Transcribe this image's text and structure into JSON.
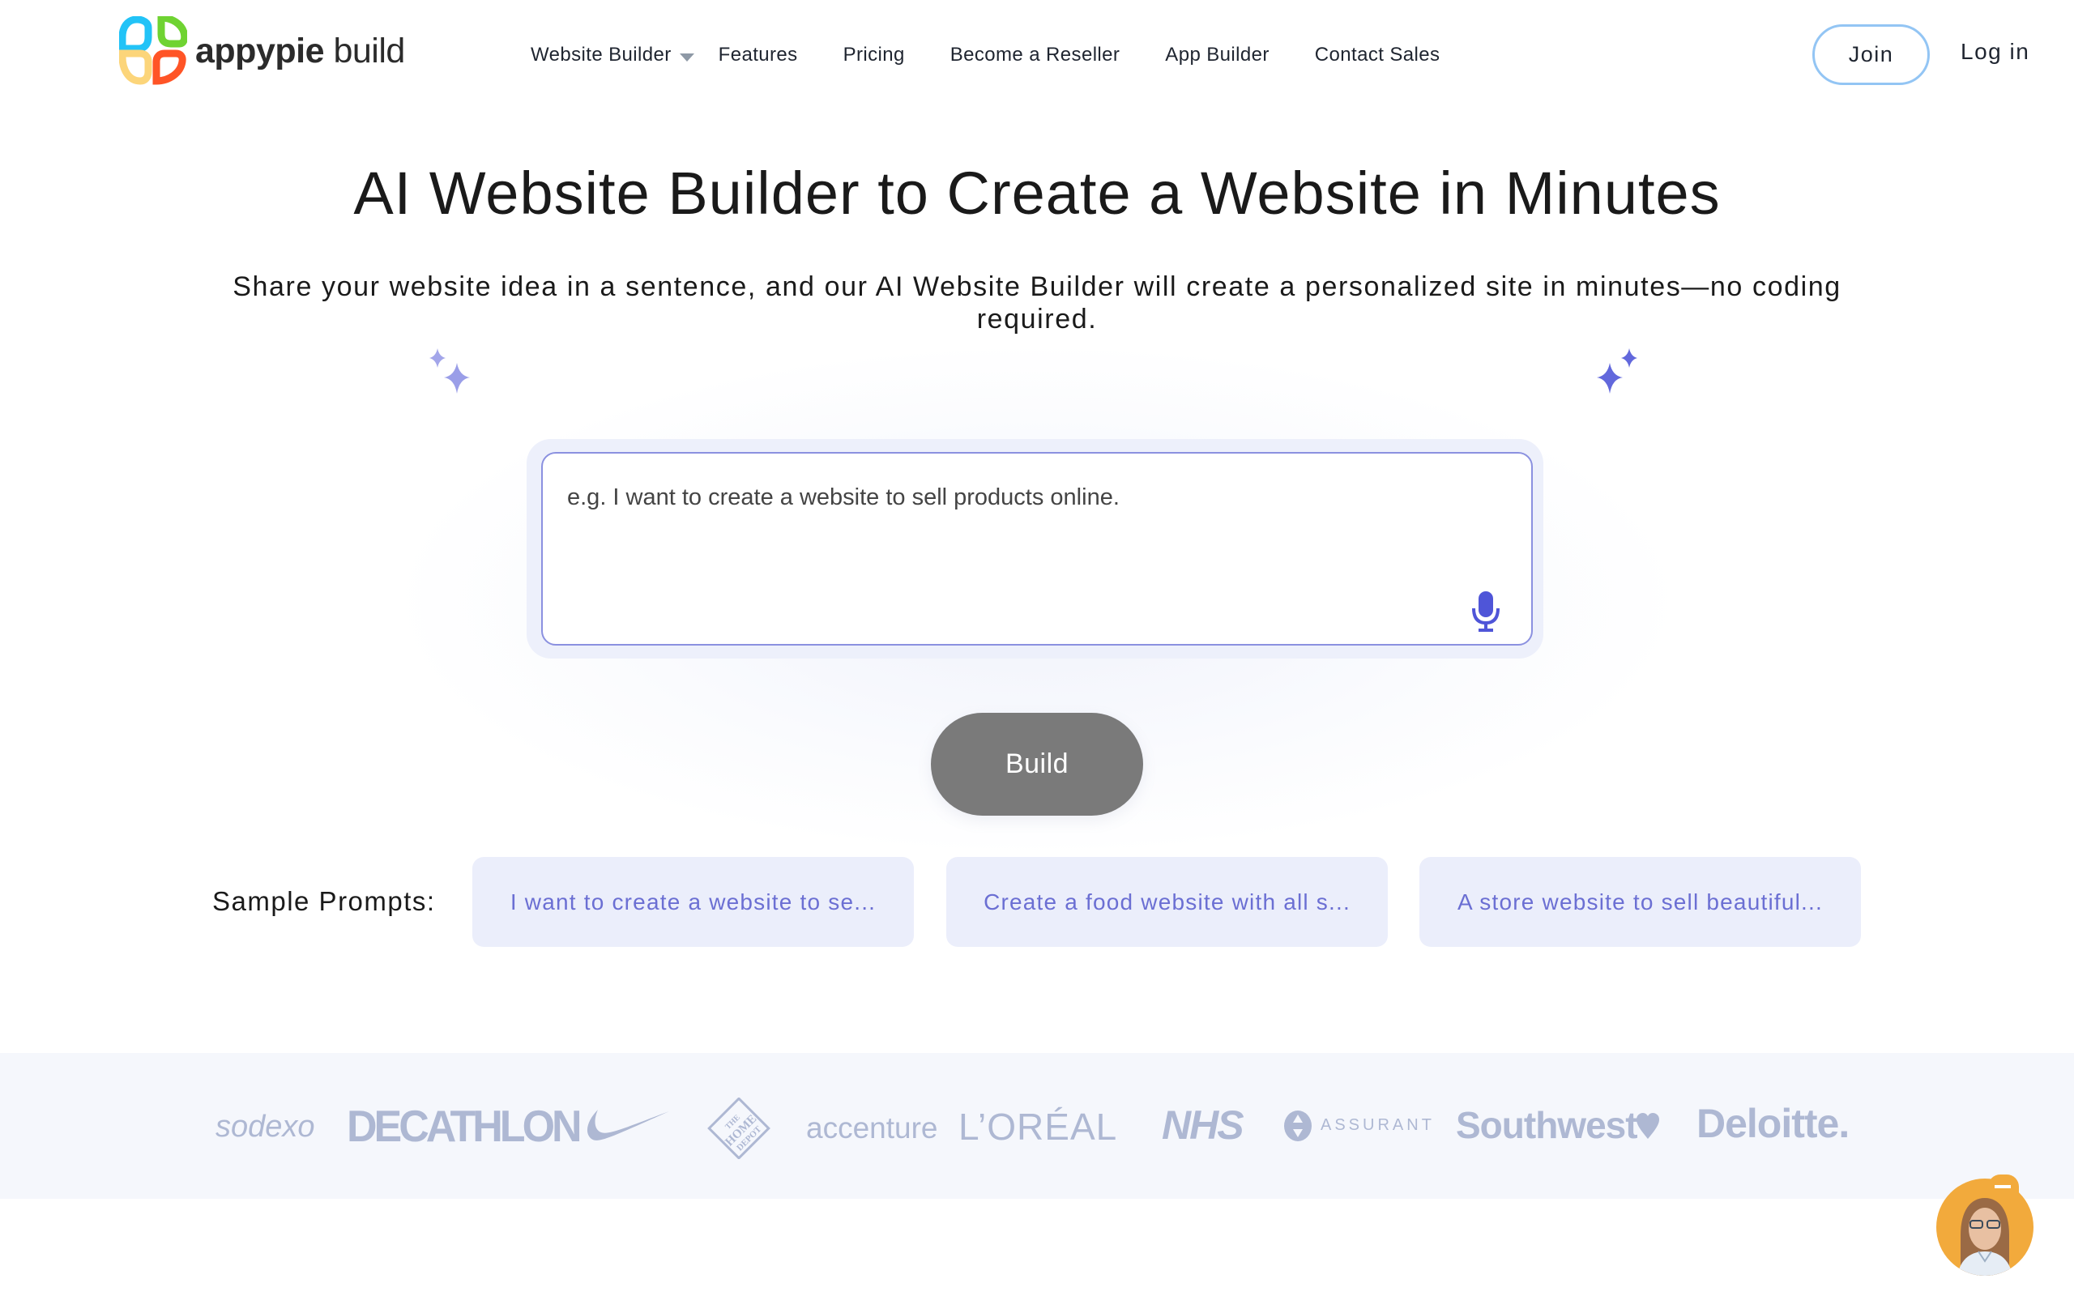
{
  "header": {
    "logo": {
      "brand_bold": "appypie",
      "brand_light": "build",
      "icon": "appypie-clover-logo-icon"
    },
    "nav": [
      {
        "label": "Website Builder",
        "has_dropdown": true
      },
      {
        "label": "Features",
        "has_dropdown": false
      },
      {
        "label": "Pricing",
        "has_dropdown": false
      },
      {
        "label": "Become a Reseller",
        "has_dropdown": false
      },
      {
        "label": "App Builder",
        "has_dropdown": false
      },
      {
        "label": "Contact Sales",
        "has_dropdown": false
      }
    ],
    "join_label": "Join",
    "login_label": "Log in"
  },
  "hero": {
    "title": "AI Website Builder to Create a Website in Minutes",
    "subtitle": "Share your website idea in a sentence, and our AI Website Builder will create a personalized site in minutes—no coding required.",
    "sparkle_icon": "sparkle-icon"
  },
  "prompt": {
    "value": "",
    "placeholder": "e.g. I want to create a website to sell products online.",
    "mic_icon": "microphone-icon"
  },
  "build_label": "Build",
  "samples": {
    "label": "Sample Prompts:",
    "chips": [
      "I want to create a website to se...",
      "Create a food website with all s...",
      "A store website to sell beautiful..."
    ]
  },
  "brands": {
    "sodexo": "sodexo",
    "decathlon": "DECATHLON",
    "nike": "nike-swoosh",
    "homedepot": "THE HOME DEPOT",
    "accenture": "accenture",
    "loreal": "L’ORÉAL",
    "nhs": "NHS",
    "assurant": "ASSURANT",
    "southwest": "Southwest",
    "deloitte": "Deloitte."
  },
  "colors": {
    "accent": "#6b6fd3",
    "build_button": "#7a7a7a",
    "join_border": "#93c5f4",
    "chip_bg": "#ebeefb",
    "logo_band_bg": "#f5f7fc",
    "brand_logo": "#aeb8d3",
    "chat_widget": "#f2aa3c"
  }
}
